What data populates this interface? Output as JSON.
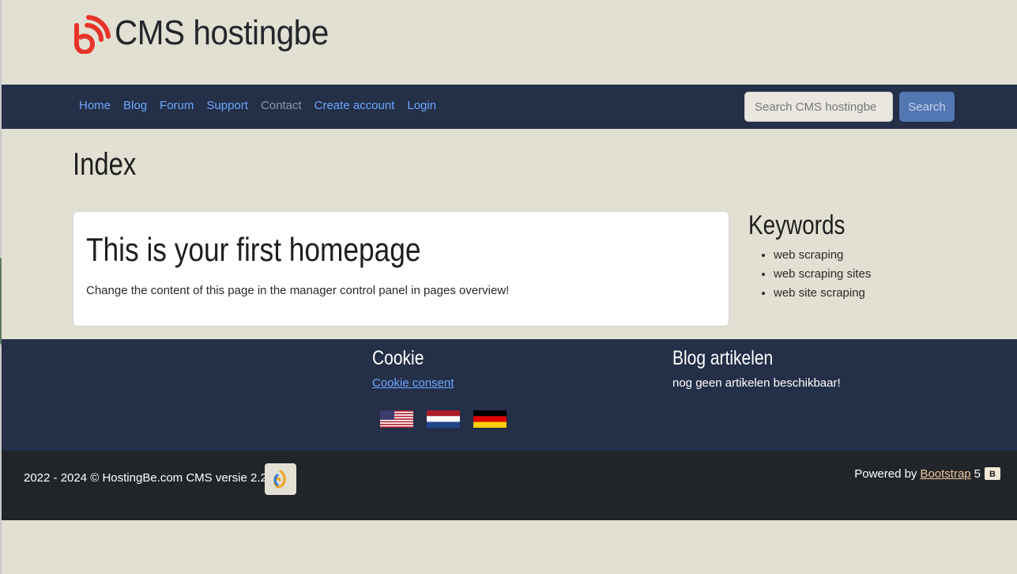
{
  "header": {
    "site_name": "CMS hostingbe"
  },
  "nav": {
    "items": [
      "Home",
      "Blog",
      "Forum",
      "Support",
      "Contact",
      "Create account",
      "Login"
    ],
    "search_placeholder": "Search CMS hostingbe",
    "search_button": "Search"
  },
  "main": {
    "page_title": "Index",
    "card": {
      "title": "This is your first homepage",
      "text": "Change the content of this page in the manager control panel in pages overview!"
    }
  },
  "sidebar": {
    "title": "Keywords",
    "items": [
      "web scraping",
      "web scraping sites",
      "web site scraping"
    ]
  },
  "footer": {
    "cookie_title": "Cookie",
    "cookie_link": "Cookie consent",
    "blog_title": "Blog artikelen",
    "blog_text": "nog geen artikelen beschikbaar!",
    "flags": [
      "us-flag-icon",
      "nl-flag-icon",
      "de-flag-icon"
    ]
  },
  "bottom": {
    "copyright": "2022 - 2024 © HostingBe.com CMS versie 2.2.3",
    "powered_prefix": "Powered by",
    "powered_link": "Bootstrap",
    "powered_suffix": "5"
  },
  "colors": {
    "background": "#e2e0d3",
    "navbar": "#242f48",
    "link": "#6ea8fe",
    "search_button": "#5277b3",
    "bottom_bar": "#212529",
    "logo": "#e8332a"
  }
}
